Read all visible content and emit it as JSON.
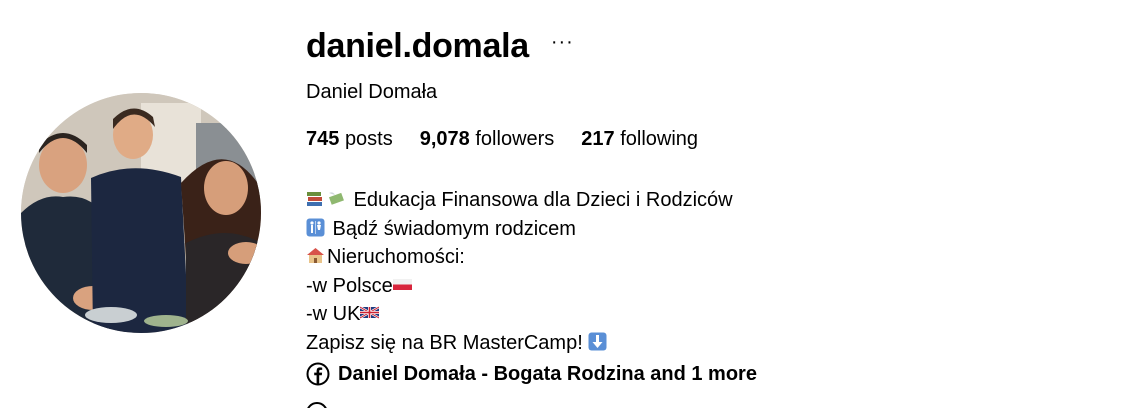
{
  "profile": {
    "username": "daniel.domala",
    "more_label": "···",
    "full_name": "Daniel Domała",
    "avatar_icon": "profile-photo"
  },
  "stats": {
    "posts_count": "745",
    "posts_label": "posts",
    "followers_count": "9,078",
    "followers_label": "followers",
    "following_count": "217",
    "following_label": "following"
  },
  "bio": {
    "line1": " Edukacja Finansowa dla Dzieci i Rodziców",
    "line2": " Bądź świadomym rodzicem",
    "line3": "Nieruchomości:",
    "line4": "-w Polsce",
    "line5": "-w UK",
    "line6": "Zapisz się na BR MasterCamp! "
  },
  "links": {
    "icon": "facebook-icon",
    "label": "Daniel Domała - Bogata Rodzina and 1 more"
  },
  "colors": {
    "text": "#000000",
    "background": "#ffffff",
    "emoji_blue": "#5a8fd6"
  }
}
